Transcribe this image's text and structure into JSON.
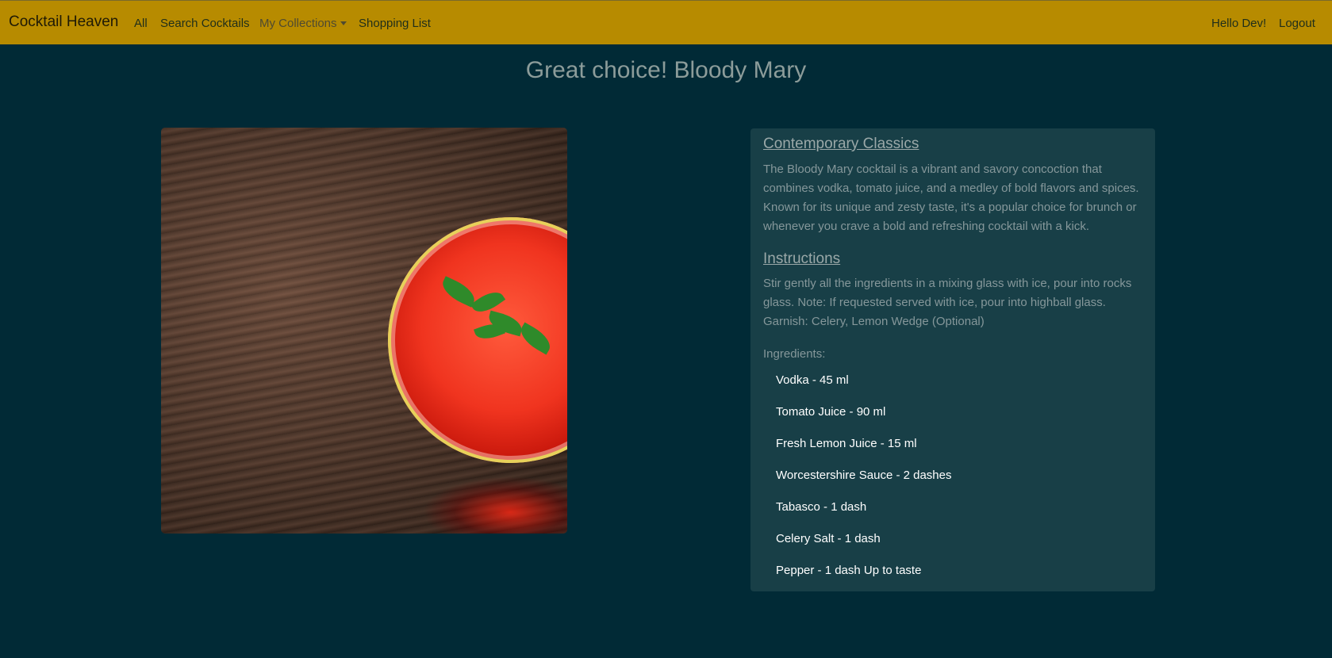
{
  "navbar": {
    "brand": "Cocktail Heaven",
    "links": {
      "all": "All",
      "search": "Search Cocktails",
      "collections": "My Collections",
      "shopping_list": "Shopping List"
    },
    "greeting": "Hello Dev!",
    "logout": "Logout"
  },
  "page": {
    "title": "Great choice! Bloody Mary"
  },
  "details": {
    "category_heading": "Contemporary Classics",
    "description": "The Bloody Mary cocktail is a vibrant and savory concoction that combines vodka, tomato juice, and a medley of bold flavors and spices. Known for its unique and zesty taste, it's a popular choice for brunch or whenever you crave a bold and refreshing cocktail with a kick.",
    "instructions_heading": "Instructions",
    "instructions": "Stir gently all the ingredients in a mixing glass with ice, pour into rocks glass. Note: If requested served with ice, pour into highball glass. Garnish: Celery, Lemon Wedge (Optional)",
    "ingredients_label": "Ingredients:",
    "ingredients": [
      "Vodka - 45 ml",
      "Tomato Juice - 90 ml",
      "Fresh Lemon Juice - 15 ml",
      "Worcestershire Sauce - 2 dashes",
      "Tabasco - 1 dash",
      "Celery Salt - 1 dash",
      "Pepper - 1 dash Up to taste"
    ]
  },
  "colors": {
    "navbar": "#b78b00",
    "background": "#012a36",
    "card": "#183f47"
  }
}
